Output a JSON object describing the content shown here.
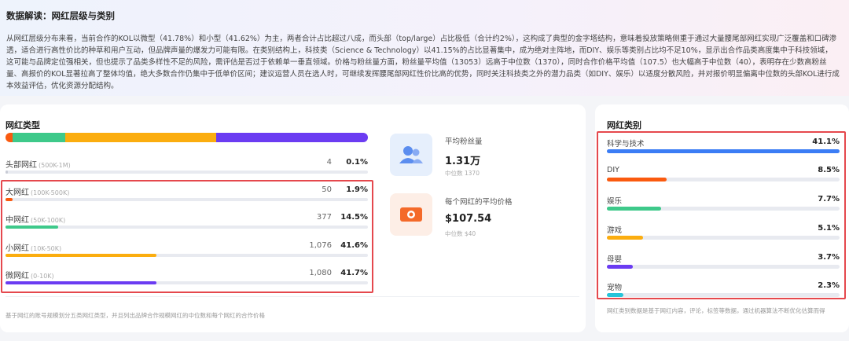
{
  "insight": {
    "title": "数据解读：网红层级与类别",
    "body": "从网红层级分布来看，当前合作的KOL以微型（41.78%）和小型（41.62%）为主，两者合计占比超过八成，而头部（top/large）占比极低（合计约2%），这构成了典型的金字塔结构，意味着投放策略侧重于通过大量腰尾部网红实现广泛覆盖和口碑渗透，适合进行高性价比的种草和用户互动，但品牌声量的爆发力可能有限。在类别结构上，科技类（Science & Technology）以41.15%的占比显著集中，成为绝对主阵地，而DIY、娱乐等类别占比均不足10%，显示出合作品类高度集中于科技领域，这可能与品牌定位强相关，但也提示了品类多样性不足的风险，需评估是否过于依赖单一垂直领域。价格与粉丝量方面，粉丝量平均值（13053）远高于中位数（1370），同时合作价格平均值（107.5）也大幅高于中位数（40），表明存在少数高粉丝量、高报价的KOL显著拉高了整体均值，绝大多数合作仍集中于低单价区间；建议运营人员在选人时，可继续发挥腰尾部网红性价比高的优势，同时关注科技类之外的潜力品类（如DIY、娱乐）以适度分散风险，并对报价明显偏离中位数的头部KOL进行成本效益评估，优化资源分配结构。"
  },
  "types": {
    "title": "网红类型",
    "stack_colors": [
      "#fa5a0f",
      "#3ec98a",
      "#fbad0f",
      "#6b3cf2"
    ],
    "stack_values": [
      1.9,
      14.5,
      41.6,
      41.7
    ],
    "tiers": [
      {
        "name": "头部网红",
        "range": "(500K-1M)",
        "count": "4",
        "pct": "0.1%",
        "value": 0.1,
        "color": "#c9ccd6"
      },
      {
        "name": "大网红",
        "range": "(100K-500K)",
        "count": "50",
        "pct": "1.9%",
        "value": 1.9,
        "color": "#fa5a0f"
      },
      {
        "name": "中网红",
        "range": "(50K-100K)",
        "count": "377",
        "pct": "14.5%",
        "value": 14.5,
        "color": "#3ec98a"
      },
      {
        "name": "小网红",
        "range": "(10K-50K)",
        "count": "1,076",
        "pct": "41.6%",
        "value": 41.6,
        "color": "#fbad0f"
      },
      {
        "name": "微网红",
        "range": "(0-10K)",
        "count": "1,080",
        "pct": "41.7%",
        "value": 41.7,
        "color": "#6b3cf2"
      }
    ],
    "footnote": "基于网红的账号规模划分五类网红类型，并且列出品牌合作规模网红的中位数和每个网红的合作价格"
  },
  "stats": {
    "fans": {
      "label": "平均粉丝量",
      "value": "1.31万",
      "sub": "中位数 1370",
      "icon": "users-icon"
    },
    "price": {
      "label": "每个网红的平均价格",
      "value": "$107.54",
      "sub": "中位数 $40",
      "icon": "money-icon"
    }
  },
  "categories": {
    "title": "网红类别",
    "items": [
      {
        "name": "科学与技术",
        "pct": "41.1%",
        "value": 41.1,
        "color": "#3b7df5"
      },
      {
        "name": "DIY",
        "pct": "8.5%",
        "value": 8.5,
        "color": "#fa5a0f"
      },
      {
        "name": "娱乐",
        "pct": "7.7%",
        "value": 7.7,
        "color": "#3ec98a"
      },
      {
        "name": "游戏",
        "pct": "5.1%",
        "value": 5.1,
        "color": "#fbad0f"
      },
      {
        "name": "母婴",
        "pct": "3.7%",
        "value": 3.7,
        "color": "#6b3cf2"
      },
      {
        "name": "宠物",
        "pct": "2.3%",
        "value": 2.3,
        "color": "#26c4d9"
      }
    ],
    "footnote": "网红类别数据是基于网红内容，评论，标签等数据，通过机器算法不断优化估算而得"
  }
}
